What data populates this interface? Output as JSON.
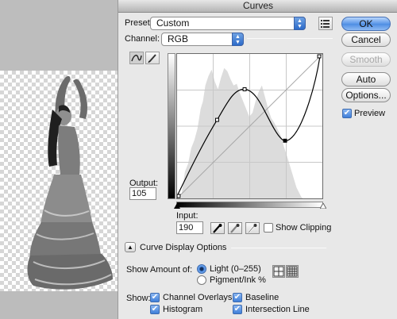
{
  "dialog": {
    "title": "Curves"
  },
  "preset": {
    "label": "Preset:",
    "value": "Custom"
  },
  "channel": {
    "label": "Channel:",
    "value": "RGB"
  },
  "output": {
    "label": "Output:",
    "value": "105"
  },
  "input": {
    "label": "Input:",
    "value": "190"
  },
  "show_clipping": {
    "label": "Show Clipping",
    "checked": false
  },
  "buttons": {
    "ok": "OK",
    "cancel": "Cancel",
    "smooth": "Smooth",
    "auto": "Auto",
    "options": "Options..."
  },
  "preview": {
    "label": "Preview",
    "checked": true
  },
  "curve_display": {
    "label": "Curve Display Options"
  },
  "show_amount": {
    "label": "Show Amount of:",
    "light": "Light  (0–255)",
    "pigment": "Pigment/Ink %",
    "selected": "light"
  },
  "show": {
    "label": "Show:",
    "channel_overlays": "Channel Overlays",
    "baseline": "Baseline",
    "histogram": "Histogram",
    "intersection_line": "Intersection Line"
  },
  "icons": [
    "curve-point-tool-icon",
    "pencil-tool-icon",
    "preset-options-icon",
    "black-eyedropper-icon",
    "gray-eyedropper-icon",
    "white-eyedropper-icon",
    "grid-small-icon",
    "grid-large-icon"
  ],
  "colors": {
    "accent": "#3f7fd9",
    "dialog_bg": "#e8e8e8"
  }
}
